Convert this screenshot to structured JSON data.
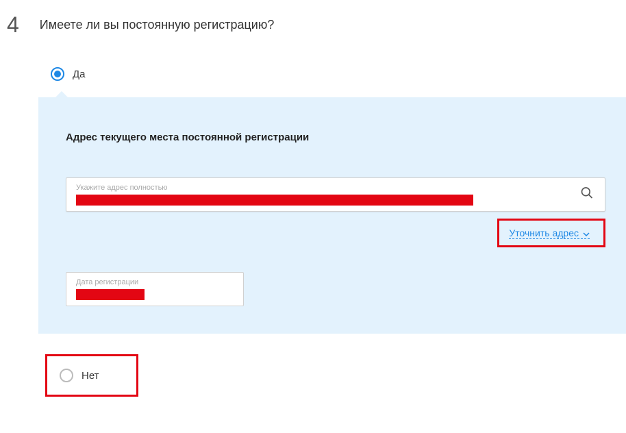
{
  "step": {
    "number": "4",
    "title": "Имеете ли вы постоянную регистрацию?"
  },
  "radios": {
    "yes": "Да",
    "no": "Нет"
  },
  "panel": {
    "title": "Адрес текущего места постоянной регистрации",
    "address": {
      "label": "Укажите адрес полностью"
    },
    "refine_link": "Уточнить адрес",
    "date": {
      "label": "Дата регистрации"
    }
  }
}
